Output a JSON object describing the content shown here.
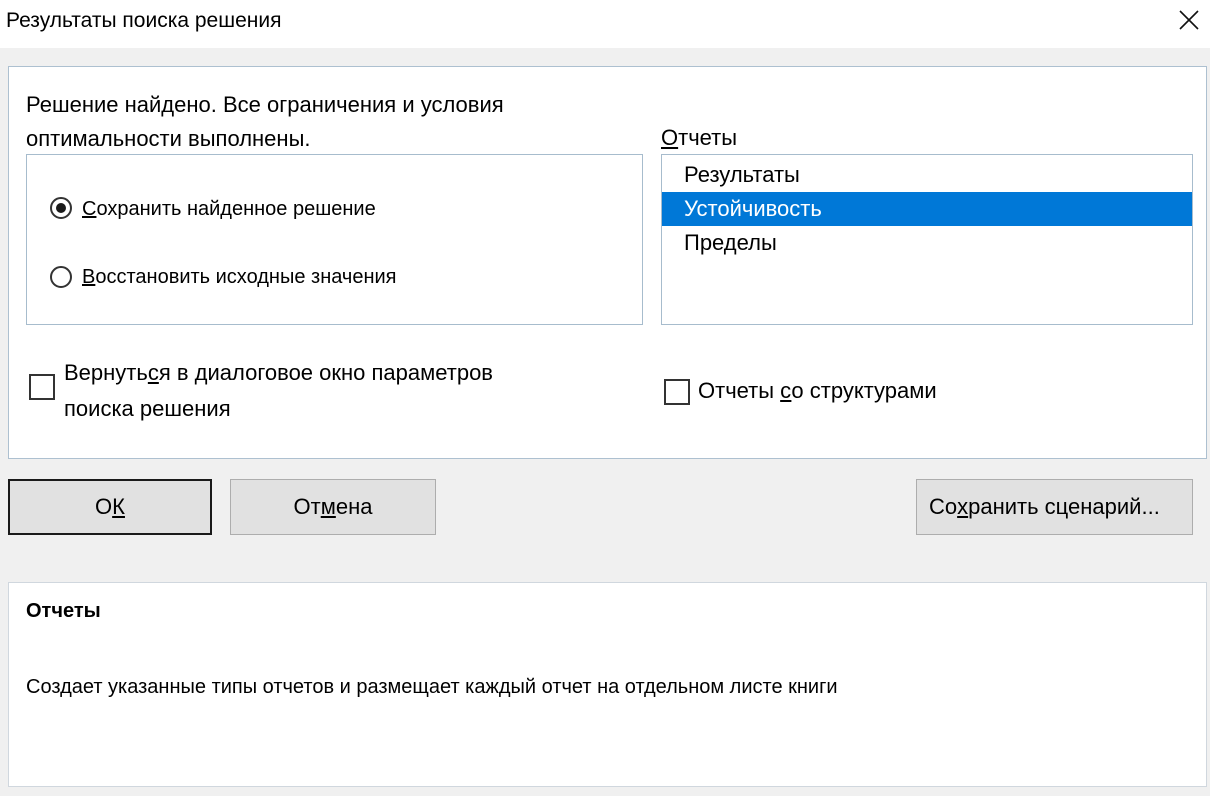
{
  "window": {
    "title": "Результаты поиска решения",
    "close_icon": "close-icon"
  },
  "status": {
    "message": "Решение найдено. Все ограничения и условия оптимальности выполнены."
  },
  "options": {
    "keep_solution": {
      "pre": "",
      "key": "С",
      "post": "охранить найденное решение",
      "selected": true
    },
    "restore_values": {
      "pre": "",
      "key": "В",
      "post": "осстановить исходные значения",
      "selected": false
    }
  },
  "reports": {
    "label_key": "О",
    "label_rest": "тчеты",
    "items": [
      "Результаты",
      "Устойчивость",
      "Пределы"
    ],
    "selected_index": 1
  },
  "return_checkbox": {
    "line1_pre": "Вернуть",
    "line1_key": "с",
    "line1_post": "я в диалоговое окно параметров",
    "line2": "поиска решения",
    "checked": false
  },
  "outline_checkbox": {
    "pre": "Отчеты ",
    "key": "с",
    "post": "о структурами",
    "checked": false
  },
  "buttons": {
    "ok": {
      "pre": "О",
      "key": "К",
      "post": ""
    },
    "cancel": {
      "pre": "От",
      "key": "м",
      "post": "ена"
    },
    "save_scenario": {
      "pre": "Со",
      "key": "х",
      "post": "ранить сценарий..."
    }
  },
  "help": {
    "title": "Отчеты",
    "text": "Создает указанные типы отчетов и размещает каждый отчет на отдельном листе книги"
  },
  "colors": {
    "selection": "#0078d7",
    "background": "#f0f0f0",
    "panel": "#ffffff"
  }
}
